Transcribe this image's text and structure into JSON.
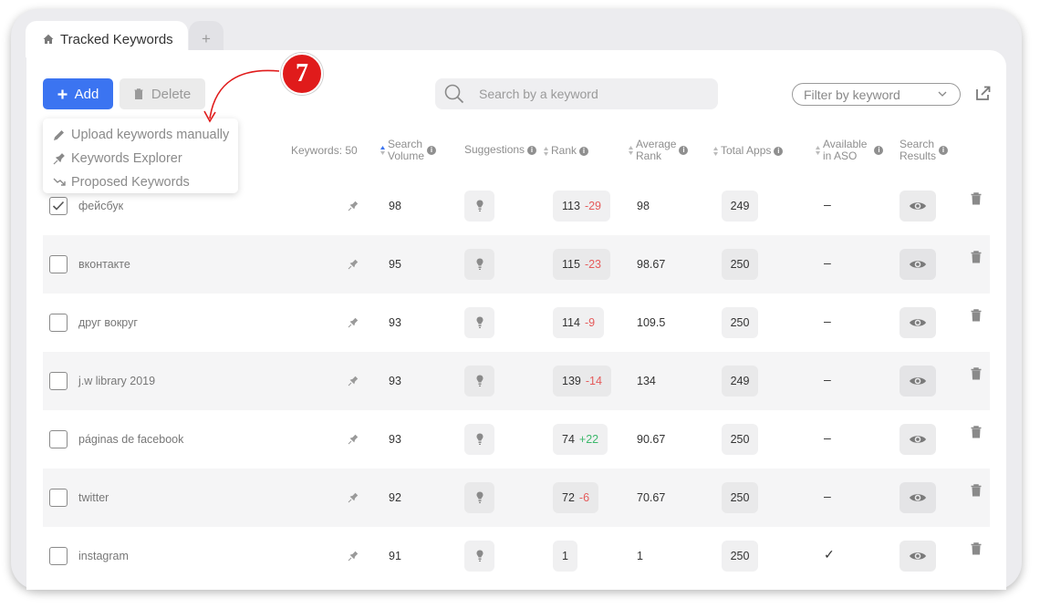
{
  "tabs": {
    "active_label": "Tracked Keywords",
    "add_label": "+"
  },
  "toolbar": {
    "add_label": "Add",
    "delete_label": "Delete",
    "search_placeholder": "Search by a keyword",
    "filter_placeholder": "Filter by keyword"
  },
  "dropdown": {
    "items": [
      {
        "label": "Upload keywords manually",
        "icon": "pencil-icon"
      },
      {
        "label": "Keywords Explorer",
        "icon": "pin-icon"
      },
      {
        "label": "Proposed Keywords",
        "icon": "trend-icon"
      }
    ]
  },
  "callout": {
    "number": "7"
  },
  "table": {
    "headers": {
      "keywords": "Keywords: 50",
      "search_volume_1": "Search",
      "search_volume_2": "Volume",
      "suggestions": "Suggestions",
      "rank": "Rank",
      "average_rank_1": "Average",
      "average_rank_2": "Rank",
      "total_apps": "Total Apps",
      "available_1": "Available",
      "available_2": "in ASO",
      "results_1": "Search",
      "results_2": "Results"
    },
    "rows": [
      {
        "keyword": "фейсбук",
        "checked": true,
        "volume": "98",
        "rank": "113",
        "delta": "-29",
        "delta_dir": "neg",
        "avg_rank": "98",
        "total_apps": "249",
        "aso": "–"
      },
      {
        "keyword": "вконтакте",
        "checked": false,
        "volume": "95",
        "rank": "115",
        "delta": "-23",
        "delta_dir": "neg",
        "avg_rank": "98.67",
        "total_apps": "250",
        "aso": "–"
      },
      {
        "keyword": "друг вокруг",
        "checked": false,
        "volume": "93",
        "rank": "114",
        "delta": "-9",
        "delta_dir": "neg",
        "avg_rank": "109.5",
        "total_apps": "250",
        "aso": "–"
      },
      {
        "keyword": "j.w library 2019",
        "checked": false,
        "volume": "93",
        "rank": "139",
        "delta": "-14",
        "delta_dir": "neg",
        "avg_rank": "134",
        "total_apps": "249",
        "aso": "–"
      },
      {
        "keyword": "páginas de facebook",
        "checked": false,
        "volume": "93",
        "rank": "74",
        "delta": "+22",
        "delta_dir": "pos",
        "avg_rank": "90.67",
        "total_apps": "250",
        "aso": "–"
      },
      {
        "keyword": "twitter",
        "checked": false,
        "volume": "92",
        "rank": "72",
        "delta": "-6",
        "delta_dir": "neg",
        "avg_rank": "70.67",
        "total_apps": "250",
        "aso": "–"
      },
      {
        "keyword": "instagram",
        "checked": false,
        "volume": "91",
        "rank": "1",
        "delta": "",
        "delta_dir": "none",
        "avg_rank": "1",
        "total_apps": "250",
        "aso": "✓"
      }
    ]
  },
  "colors": {
    "accent": "#3b74f1",
    "callout": "#e01b1b",
    "negative": "#e55b5b",
    "positive": "#3cb86b"
  }
}
